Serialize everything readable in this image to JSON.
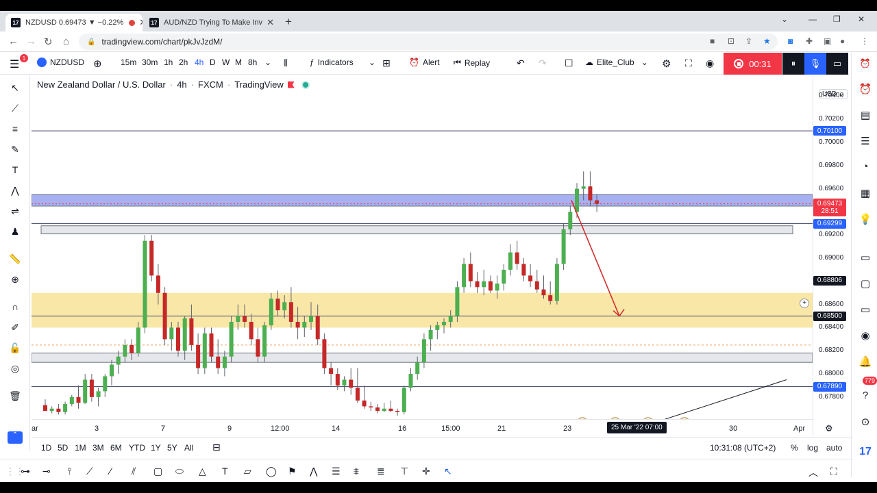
{
  "browser": {
    "tabs": [
      {
        "label": "NZDUSD 0.69473 ▼ −0.22%",
        "active": true,
        "recording": true
      },
      {
        "label": "AUD/NZD Trying To Make Inverte",
        "active": false
      }
    ],
    "url": "tradingview.com/chart/pkJvJzdM/"
  },
  "toolbar": {
    "notif_count": "1",
    "symbol": "NZDUSD",
    "intervals": [
      "15m",
      "30m",
      "1h",
      "2h",
      "4h",
      "D",
      "W",
      "M",
      "8h"
    ],
    "active_interval": "4h",
    "indicators_label": "Indicators",
    "alert_label": "Alert",
    "replay_label": "Replay",
    "layout_name": "Elite_Club",
    "rec_time": "00:31"
  },
  "legend": {
    "title": "New Zealand Dollar / U.S. Dollar",
    "interval": "4h",
    "exchange": "FXCM",
    "source": "TradingView"
  },
  "price_scale": {
    "currency": "USD",
    "ticks": [
      "0.70400",
      "0.70200",
      "0.70000",
      "0.69800",
      "0.69600",
      "0.69200",
      "0.69000",
      "0.68600",
      "0.68400",
      "0.68200",
      "0.68000",
      "0.67800"
    ],
    "labels": [
      {
        "value": "0.70100",
        "color": "#2962ff"
      },
      {
        "value": "0.69473",
        "sub": "28:51",
        "color": "#f23645"
      },
      {
        "value": "0.69299",
        "color": "#2962ff"
      },
      {
        "value": "0.68806",
        "color": "#131722"
      },
      {
        "value": "0.68500",
        "color": "#131722"
      },
      {
        "value": "0.67890",
        "color": "#2962ff"
      }
    ]
  },
  "time_scale": {
    "labels": [
      "ar",
      "3",
      "7",
      "9",
      "12:00",
      "14",
      "16",
      "15:00",
      "21",
      "23",
      "30",
      "Apr"
    ],
    "selected": "25 Mar '22   07:00"
  },
  "bottom": {
    "ranges": [
      "1D",
      "5D",
      "1M",
      "3M",
      "6M",
      "YTD",
      "1Y",
      "5Y",
      "All"
    ],
    "clock": "10:31:08 (UTC+2)",
    "percent": "%",
    "log": "log",
    "auto": "auto"
  },
  "right_badge": "779",
  "colors": {
    "up": "#4caf50",
    "down": "#c62828",
    "zone_yellow": "#f9e7a8",
    "zone_blue": "#9da8f0",
    "arrow": "#d32f2f",
    "accent": "#2962ff"
  },
  "chart_data": {
    "type": "candlestick",
    "symbol": "NZDUSD",
    "timeframe": "4h",
    "price_range": [
      0.677,
      0.706
    ],
    "candles": [
      [
        0.6773,
        0.6778,
        0.677,
        0.6768
      ],
      [
        0.6768,
        0.6772,
        0.6766,
        0.677
      ],
      [
        0.677,
        0.6774,
        0.6765,
        0.6767
      ],
      [
        0.6767,
        0.6776,
        0.6765,
        0.6774
      ],
      [
        0.6774,
        0.6782,
        0.6772,
        0.678
      ],
      [
        0.678,
        0.679,
        0.677,
        0.6775
      ],
      [
        0.6775,
        0.68,
        0.6774,
        0.6795
      ],
      [
        0.6795,
        0.68,
        0.6776,
        0.678
      ],
      [
        0.678,
        0.6788,
        0.6772,
        0.6785
      ],
      [
        0.6785,
        0.68,
        0.678,
        0.6798
      ],
      [
        0.6798,
        0.6812,
        0.679,
        0.6808
      ],
      [
        0.6808,
        0.682,
        0.68,
        0.6815
      ],
      [
        0.6815,
        0.683,
        0.681,
        0.6825
      ],
      [
        0.6825,
        0.683,
        0.6812,
        0.6818
      ],
      [
        0.6818,
        0.6845,
        0.6815,
        0.684
      ],
      [
        0.684,
        0.692,
        0.6835,
        0.6915
      ],
      [
        0.6915,
        0.692,
        0.688,
        0.6885
      ],
      [
        0.6885,
        0.6895,
        0.686,
        0.687
      ],
      [
        0.687,
        0.6875,
        0.6825,
        0.683
      ],
      [
        0.683,
        0.6845,
        0.682,
        0.684
      ],
      [
        0.684,
        0.6845,
        0.6815,
        0.682
      ],
      [
        0.682,
        0.685,
        0.6812,
        0.6848
      ],
      [
        0.6848,
        0.686,
        0.682,
        0.6825
      ],
      [
        0.6825,
        0.6835,
        0.68,
        0.6805
      ],
      [
        0.6805,
        0.684,
        0.68,
        0.6835
      ],
      [
        0.6835,
        0.684,
        0.681,
        0.6815
      ],
      [
        0.6815,
        0.683,
        0.68,
        0.6805
      ],
      [
        0.6805,
        0.682,
        0.6798,
        0.6815
      ],
      [
        0.6815,
        0.685,
        0.681,
        0.6845
      ],
      [
        0.6845,
        0.686,
        0.6838,
        0.685
      ],
      [
        0.685,
        0.686,
        0.684,
        0.6845
      ],
      [
        0.6845,
        0.6852,
        0.6825,
        0.683
      ],
      [
        0.683,
        0.684,
        0.681,
        0.6815
      ],
      [
        0.6815,
        0.6845,
        0.681,
        0.6842
      ],
      [
        0.6842,
        0.687,
        0.6838,
        0.6865
      ],
      [
        0.6865,
        0.6872,
        0.685,
        0.6855
      ],
      [
        0.6855,
        0.6868,
        0.6848,
        0.6862
      ],
      [
        0.6862,
        0.6875,
        0.684,
        0.6845
      ],
      [
        0.6845,
        0.6858,
        0.683,
        0.684
      ],
      [
        0.684,
        0.685,
        0.6832,
        0.6845
      ],
      [
        0.6845,
        0.6862,
        0.6838,
        0.685
      ],
      [
        0.685,
        0.686,
        0.6825,
        0.683
      ],
      [
        0.683,
        0.6835,
        0.68,
        0.6805
      ],
      [
        0.6805,
        0.681,
        0.679,
        0.68
      ],
      [
        0.68,
        0.6805,
        0.6786,
        0.679
      ],
      [
        0.679,
        0.6798,
        0.6785,
        0.6795
      ],
      [
        0.6795,
        0.6805,
        0.6782,
        0.6788
      ],
      [
        0.6788,
        0.6805,
        0.6775,
        0.6777
      ],
      [
        0.6777,
        0.679,
        0.677,
        0.6772
      ],
      [
        0.6772,
        0.6776,
        0.6768,
        0.6771
      ],
      [
        0.6771,
        0.6774,
        0.6766,
        0.6768
      ],
      [
        0.6768,
        0.6775,
        0.6767,
        0.677
      ],
      [
        0.677,
        0.6777,
        0.6767,
        0.6768
      ],
      [
        0.6768,
        0.677,
        0.6764,
        0.6767
      ],
      [
        0.6767,
        0.679,
        0.6765,
        0.6788
      ],
      [
        0.6788,
        0.6805,
        0.6785,
        0.68
      ],
      [
        0.68,
        0.6815,
        0.6795,
        0.681
      ],
      [
        0.681,
        0.6835,
        0.6805,
        0.683
      ],
      [
        0.683,
        0.6842,
        0.682,
        0.6838
      ],
      [
        0.6838,
        0.6845,
        0.683,
        0.6842
      ],
      [
        0.6842,
        0.6848,
        0.6835,
        0.6845
      ],
      [
        0.6845,
        0.6855,
        0.684,
        0.685
      ],
      [
        0.685,
        0.688,
        0.6845,
        0.6875
      ],
      [
        0.6875,
        0.69,
        0.687,
        0.6895
      ],
      [
        0.6895,
        0.6905,
        0.6875,
        0.688
      ],
      [
        0.688,
        0.6888,
        0.687,
        0.6875
      ],
      [
        0.6875,
        0.689,
        0.6868,
        0.688
      ],
      [
        0.688,
        0.6885,
        0.687,
        0.6872
      ],
      [
        0.6872,
        0.6885,
        0.6865,
        0.6878
      ],
      [
        0.6878,
        0.6895,
        0.6872,
        0.689
      ],
      [
        0.689,
        0.6912,
        0.6885,
        0.6905
      ],
      [
        0.6905,
        0.6915,
        0.689,
        0.6895
      ],
      [
        0.6895,
        0.69,
        0.688,
        0.6885
      ],
      [
        0.6885,
        0.6895,
        0.6875,
        0.688
      ],
      [
        0.688,
        0.689,
        0.687,
        0.6873
      ],
      [
        0.6873,
        0.6885,
        0.6865,
        0.6868
      ],
      [
        0.6868,
        0.688,
        0.686,
        0.6863
      ],
      [
        0.6863,
        0.69,
        0.686,
        0.6895
      ],
      [
        0.6895,
        0.693,
        0.689,
        0.6925
      ],
      [
        0.6925,
        0.6945,
        0.692,
        0.694
      ],
      [
        0.694,
        0.6965,
        0.6935,
        0.696
      ],
      [
        0.696,
        0.6975,
        0.695,
        0.6962
      ],
      [
        0.6962,
        0.6975,
        0.6945,
        0.695
      ],
      [
        0.695,
        0.6955,
        0.694,
        0.6947
      ]
    ],
    "zones": [
      {
        "from": 0.6945,
        "to": 0.6955,
        "color": "blue"
      },
      {
        "from": 0.684,
        "to": 0.687,
        "color": "yellow"
      },
      {
        "from": 0.681,
        "to": 0.6818,
        "color": "grey"
      },
      {
        "from": 0.6921,
        "to": 0.6928,
        "color": "grey"
      }
    ],
    "lines": [
      0.701,
      0.693,
      0.685,
      0.6789
    ],
    "dashed_line": 0.6825,
    "arrow": {
      "from_price": 0.695,
      "to_price": 0.685
    }
  }
}
